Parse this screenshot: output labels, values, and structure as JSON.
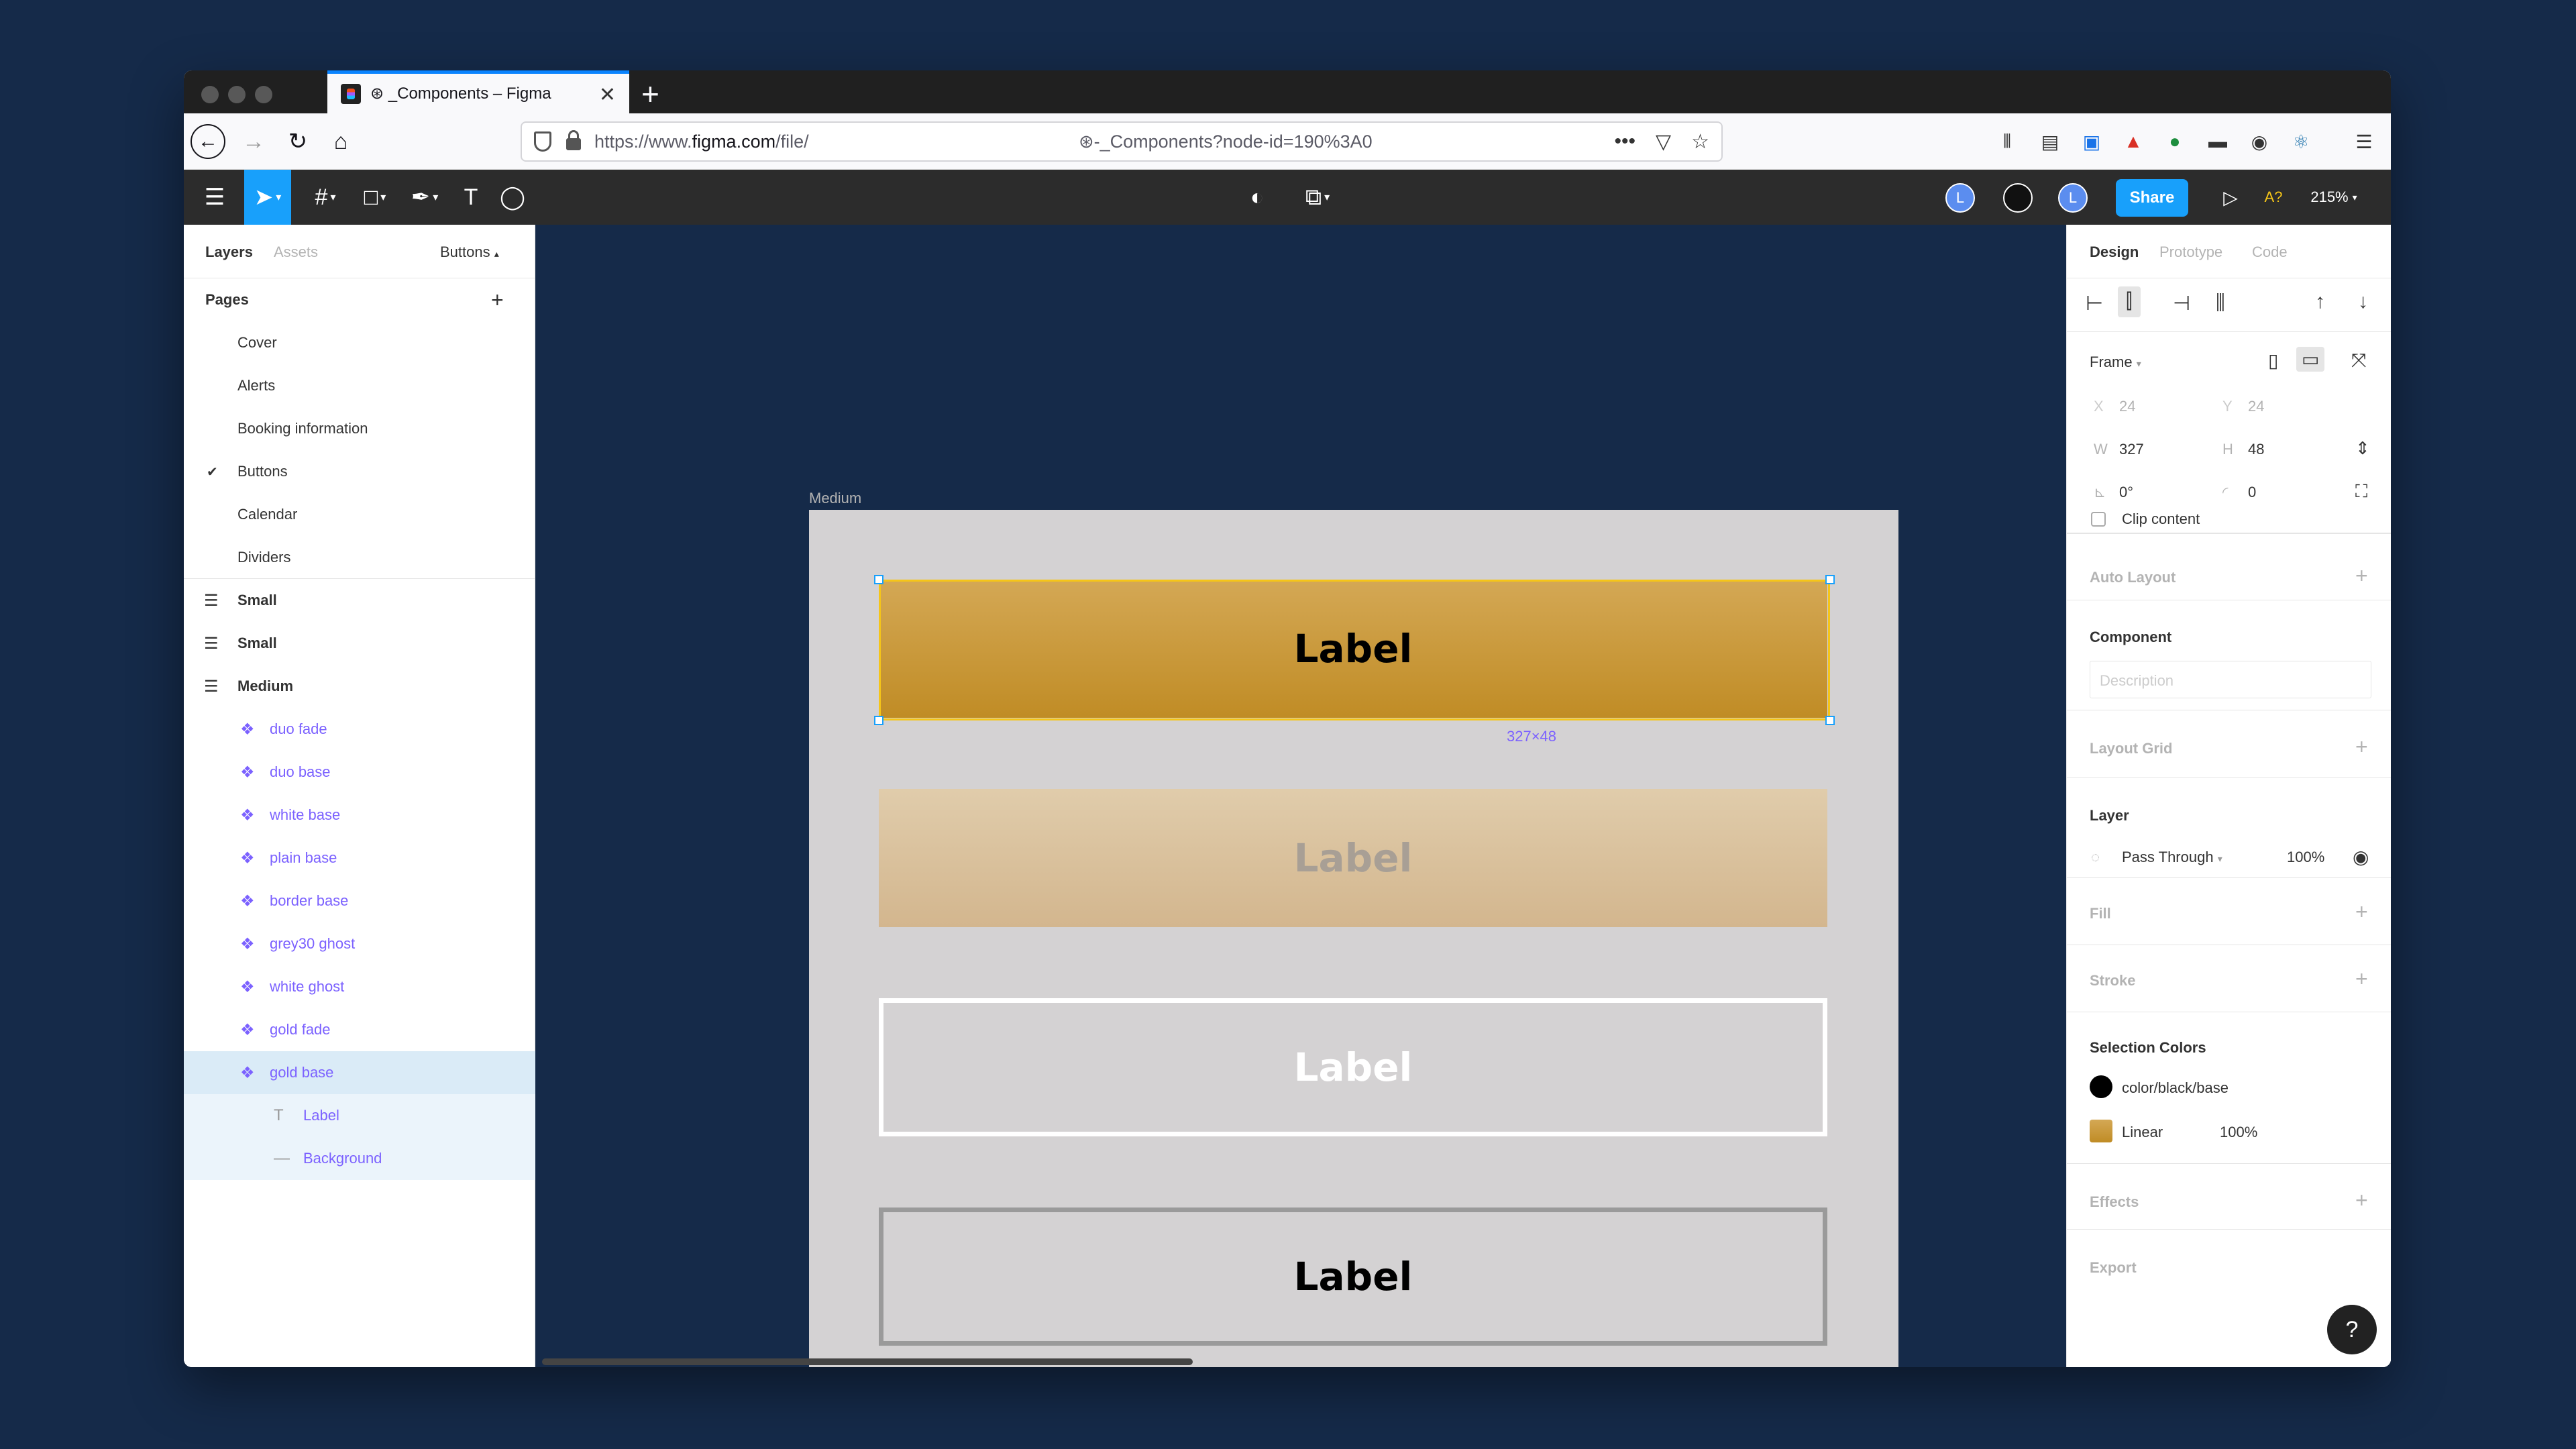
{
  "browser": {
    "tab_title": "⊛ _Components – Figma",
    "url_prefix": "https://www.",
    "url_domain": "figma.com",
    "url_path": "/file/",
    "url_tail": "⊛-_Components?node-id=190%3A0"
  },
  "figma_toolbar": {
    "share_label": "Share",
    "zoom": "215%",
    "accessibility_badge": "A?",
    "avatars": [
      "L",
      "",
      "L"
    ]
  },
  "left_panel": {
    "tabs": [
      "Layers",
      "Assets"
    ],
    "page_selector": "Buttons",
    "pages_heading": "Pages",
    "pages": [
      "Cover",
      "Alerts",
      "Booking information",
      "Buttons",
      "Calendar",
      "Dividers"
    ],
    "frames": [
      "Small",
      "Small",
      "Medium"
    ],
    "components": [
      "duo fade",
      "duo base",
      "white base",
      "plain base",
      "border base",
      "grey30 ghost",
      "white ghost",
      "gold fade",
      "gold base"
    ],
    "children": [
      "Label",
      "Background"
    ]
  },
  "canvas": {
    "frame_label": "Medium",
    "selection_size": "327×48",
    "buttons": [
      {
        "label": "Label",
        "style": "gold base"
      },
      {
        "label": "Label",
        "style": "gold fade"
      },
      {
        "label": "Label",
        "style": "white ghost"
      },
      {
        "label": "Label",
        "style": "grey30 ghost"
      }
    ]
  },
  "right_panel": {
    "tabs": [
      "Design",
      "Prototype",
      "Code"
    ],
    "frame_label": "Frame",
    "x_label": "X",
    "x_value": "24",
    "y_label": "Y",
    "y_value": "24",
    "w_label": "W",
    "w_value": "327",
    "h_label": "H",
    "h_value": "48",
    "rotation": "0°",
    "radius": "0",
    "clip_content": "Clip content",
    "auto_layout": "Auto Layout",
    "component_heading": "Component",
    "description_placeholder": "Description",
    "layout_grid": "Layout Grid",
    "layer_heading": "Layer",
    "blend_mode": "Pass Through",
    "opacity": "100%",
    "fill": "Fill",
    "stroke": "Stroke",
    "selection_colors_heading": "Selection Colors",
    "selection_colors": [
      {
        "name": "color/black/base",
        "opacity": "",
        "swatch": "#000000"
      },
      {
        "name": "Linear",
        "opacity": "100%",
        "swatch": "#c9a04a"
      }
    ],
    "effects": "Effects",
    "export": "Export"
  },
  "colors": {
    "desktop": "#152a49",
    "figma_blue": "#18a0fb",
    "component_purple": "#7b61ff",
    "gold": "#c9a04a"
  }
}
